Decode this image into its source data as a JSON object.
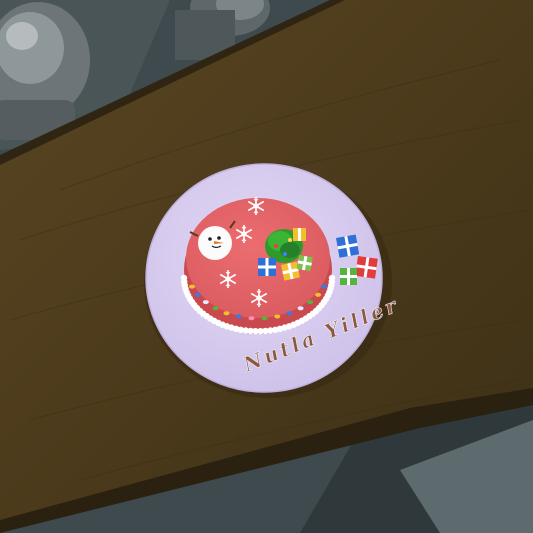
{
  "scene": {
    "plate_inscription": "Nutla Yiller",
    "colors": {
      "floor": "#3f4a4e",
      "table_wood": "#4a3a1c",
      "table_wood_light": "#5a4722",
      "table_edge": "#2c2210",
      "plate": "#d9cdf0",
      "plate_rim": "#cbbde6",
      "cake_top": "#e06468",
      "cake_side": "#d4585c",
      "frosting": "#ffffff",
      "inscription": "#8a5a3a"
    }
  }
}
